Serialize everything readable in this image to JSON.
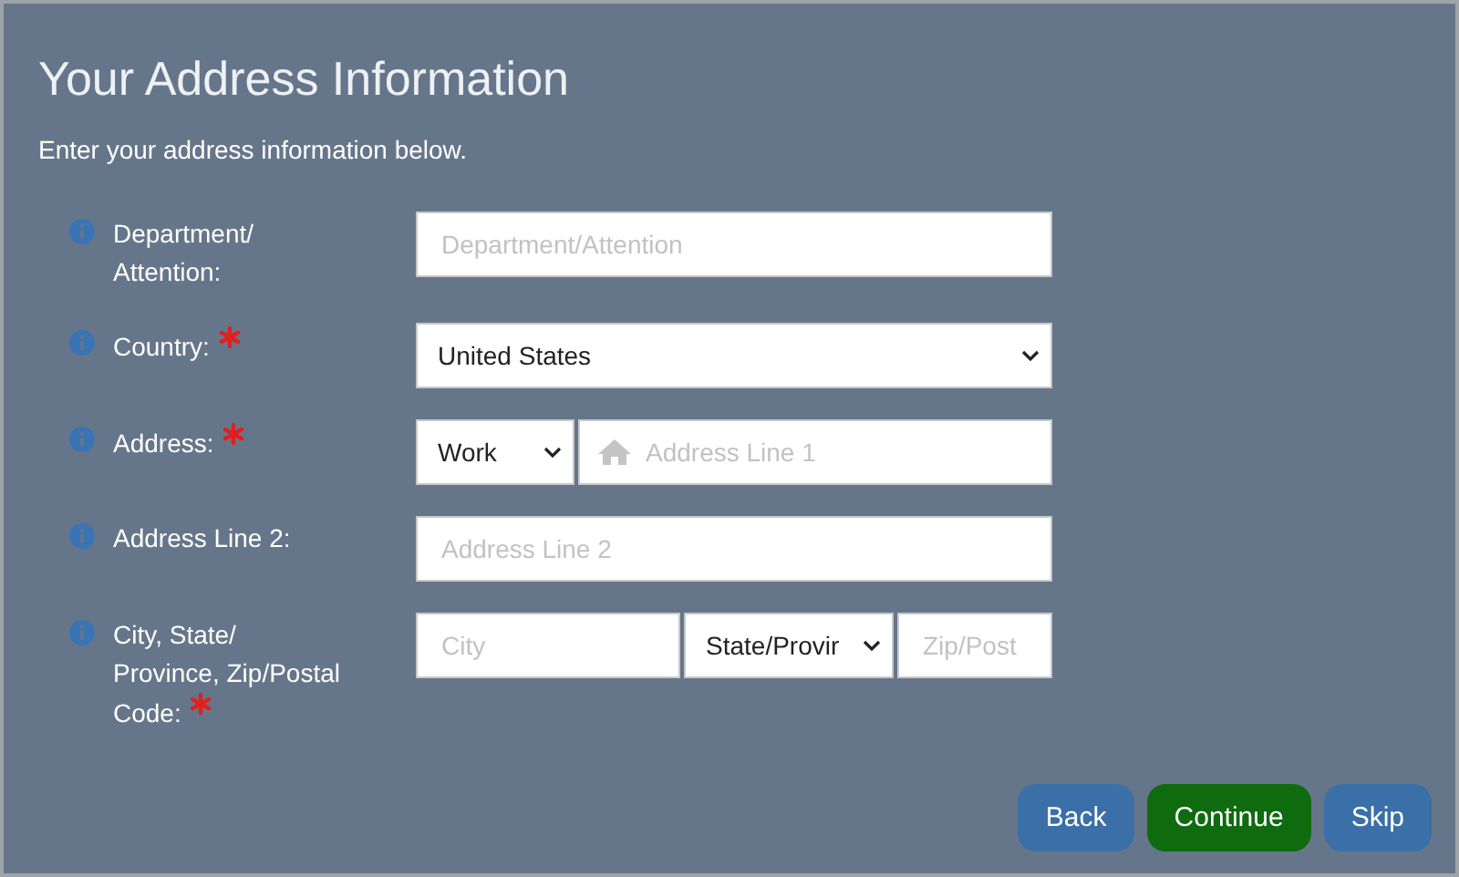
{
  "title": "Your Address Information",
  "subtitle": "Enter your address information below.",
  "rows": [
    {
      "label": "Department/ Attention:",
      "required": false,
      "controls": [
        {
          "kind": "input",
          "placeholder": "Department/Attention"
        }
      ]
    },
    {
      "label": "Country:",
      "required": true,
      "controls": [
        {
          "kind": "select",
          "value": "United States"
        }
      ]
    },
    {
      "label": "Address:",
      "required": true,
      "controls": [
        {
          "kind": "select",
          "value": "Work"
        },
        {
          "kind": "home-input",
          "placeholder": "Address Line 1"
        }
      ]
    },
    {
      "label": "Address Line 2:",
      "required": false,
      "controls": [
        {
          "kind": "input",
          "placeholder": "Address Line 2"
        }
      ]
    },
    {
      "label": "City, State/ Province, Zip/Postal Code:",
      "required": true,
      "controls": [
        {
          "kind": "input",
          "placeholder": "City"
        },
        {
          "kind": "select",
          "value": "State/Provir"
        },
        {
          "kind": "input",
          "placeholder": "Zip/Post"
        }
      ]
    }
  ],
  "buttons": [
    {
      "label": "Back",
      "kind": "secondary"
    },
    {
      "label": "Continue",
      "kind": "primary"
    },
    {
      "label": "Skip",
      "kind": "secondary"
    }
  ]
}
